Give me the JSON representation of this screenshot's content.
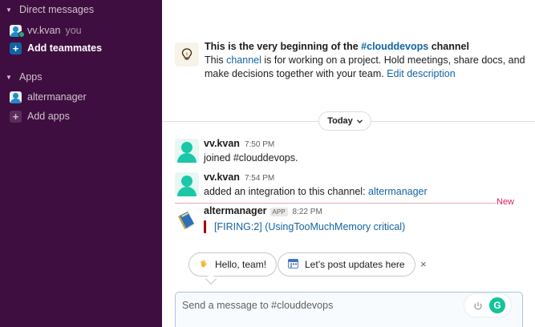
{
  "sidebar": {
    "direct_messages_label": "Direct messages",
    "user_name": "vv.kvan",
    "user_suffix": "you",
    "add_teammates_label": "Add teammates",
    "apps_label": "Apps",
    "app_name": "altermanager",
    "add_apps_label": "Add apps",
    "colors": {
      "background": "#3f0e40",
      "active_plus": "#1164a3",
      "presence": "#2bac76"
    }
  },
  "intro": {
    "icon": "lightbulb-icon",
    "title_prefix": "This is the very beginning of the ",
    "channel_link": "#clouddevops",
    "title_suffix": " channel",
    "desc_prefix": "This ",
    "desc_bold": "channel",
    "desc_rest": " is for working on a project. Hold meetings, share docs, and make decisions together with your team. ",
    "edit_link": "Edit description"
  },
  "divider": {
    "today_label": "Today",
    "new_label": "New"
  },
  "messages": [
    {
      "author": "vv.kvan",
      "time": "7:50 PM",
      "text": "joined #clouddevops."
    },
    {
      "author": "vv.kvan",
      "time": "7:54 PM",
      "text_prefix": "added an integration to this channel: ",
      "link": "altermanager"
    },
    {
      "author": "altermanager",
      "badge": "APP",
      "time": "8:22 PM",
      "attachment": "[FIRING:2]  (UsingTooMuchMemory critical)"
    }
  ],
  "suggestions": {
    "hello": "Hello, team!",
    "hello_icon": "waving-hand-icon",
    "post": "Let’s post updates here",
    "post_icon": "calendar-icon",
    "dismiss": "×"
  },
  "composer": {
    "placeholder": "Send a message to #clouddevops",
    "grammarly_letter": "G"
  }
}
